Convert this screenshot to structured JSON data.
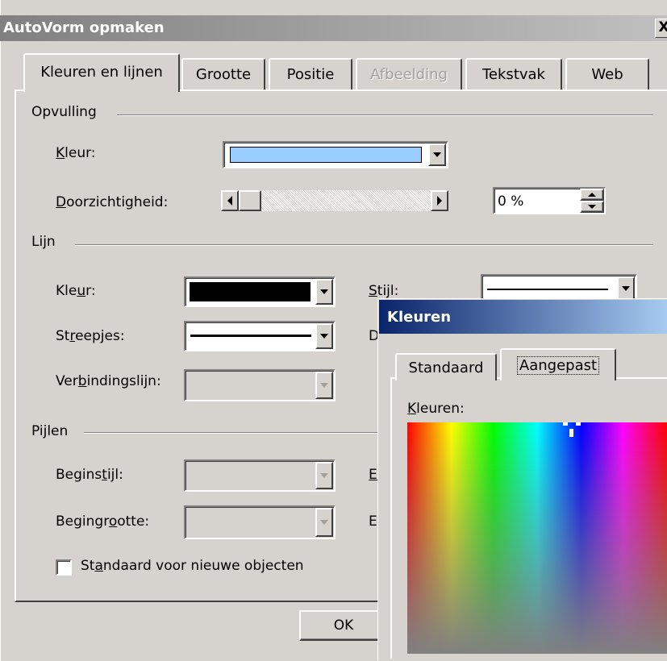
{
  "dialog": {
    "title": "AutoVorm opmaken",
    "close_label": "X",
    "tabs": [
      {
        "label": "Kleuren en lijnen",
        "active": true
      },
      {
        "label": "Grootte"
      },
      {
        "label": "Positie"
      },
      {
        "label": "Afbeelding",
        "disabled": true
      },
      {
        "label": "Tekstvak"
      },
      {
        "label": "Web"
      }
    ],
    "fill": {
      "section": "Opvulling",
      "color_label_pre": "",
      "color_label_key": "K",
      "color_label_post": "leur:",
      "color_value": "#99ccff",
      "transparency_label_pre": "",
      "transparency_label_key": "D",
      "transparency_label_post": "oorzichtigheid:",
      "transparency_value": "0 %",
      "transparency_level": 0
    },
    "line": {
      "section": "Lijn",
      "color_label_pre": "Kle",
      "color_label_key": "u",
      "color_label_post": "r:",
      "color_value": "#000000",
      "style_label_pre": "",
      "style_label_key": "S",
      "style_label_post": "tijl:",
      "dash_label_pre": "St",
      "dash_label_key": "r",
      "dash_label_post": "eepjes:",
      "connector_label_pre": "Ver",
      "connector_label_key": "b",
      "connector_label_post": "indingslijn:",
      "second_col_d": "D"
    },
    "arrows": {
      "section": "Pijlen",
      "begin_style_label_pre": "Begins",
      "begin_style_label_key": "t",
      "begin_style_label_post": "ijl:",
      "begin_size_label_pre": "Begingr",
      "begin_size_label_key": "o",
      "begin_size_label_post": "otte:",
      "end_style_initial": "E",
      "end_size_initial": "E"
    },
    "default_checkbox": {
      "pre": "St",
      "key": "a",
      "post": "ndaard voor nieuwe objecten",
      "checked": false
    },
    "ok_label": "OK"
  },
  "colors_dialog": {
    "title": "Kleuren",
    "tabs": [
      {
        "label": "Standaard"
      },
      {
        "label": "Aangepast",
        "active": true
      }
    ],
    "colors_label_pre": "",
    "colors_label_key": "K",
    "colors_label_post": "leuren:"
  }
}
